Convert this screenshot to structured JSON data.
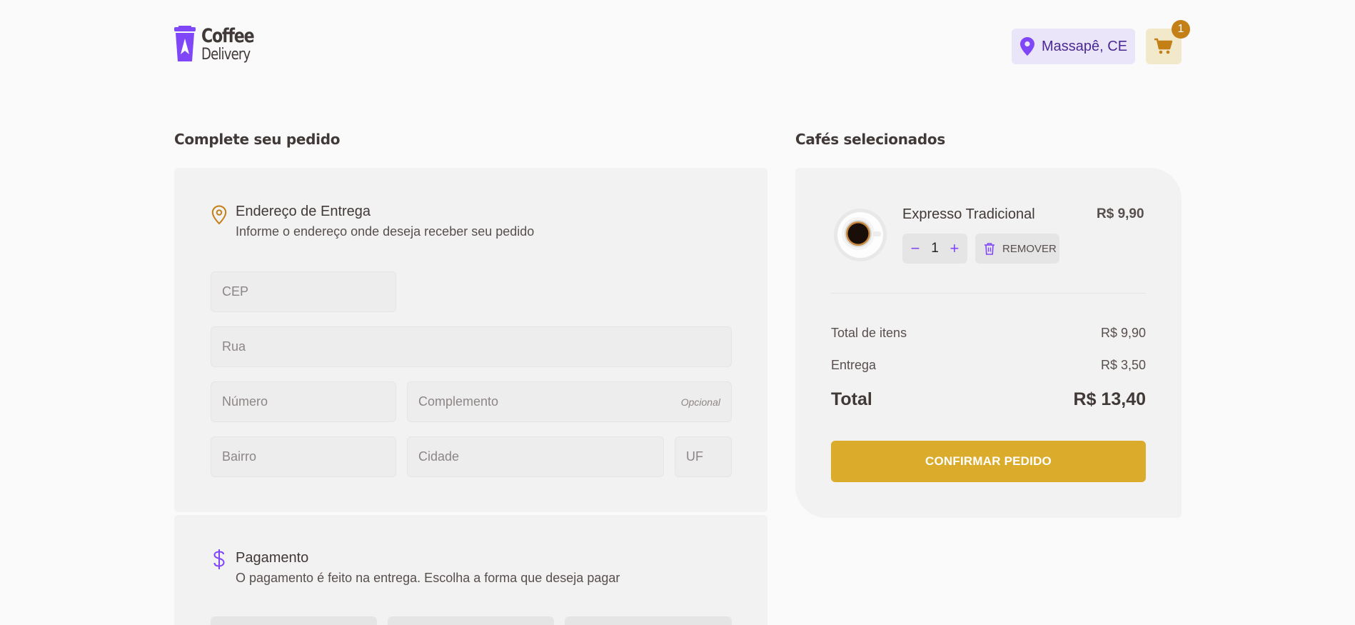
{
  "brand": {
    "line1": "Coffee",
    "line2": "Delivery"
  },
  "header": {
    "location": "Massapê, CE",
    "cart_count": "1"
  },
  "checkout": {
    "title": "Complete seu pedido",
    "address": {
      "title": "Endereço de Entrega",
      "subtitle": "Informe o endereço onde deseja receber seu pedido",
      "fields": {
        "cep": "CEP",
        "rua": "Rua",
        "numero": "Número",
        "complemento": "Complemento",
        "complemento_hint": "Opcional",
        "bairro": "Bairro",
        "cidade": "Cidade",
        "uf": "UF"
      }
    },
    "payment": {
      "title": "Pagamento",
      "subtitle": "O pagamento é feito na entrega. Escolha a forma que deseja pagar"
    }
  },
  "summary": {
    "title": "Cafés selecionados",
    "item": {
      "name": "Expresso Tradicional",
      "price": "R$ 9,90",
      "quantity": "1",
      "remove_label": "REMOVER"
    },
    "totals": {
      "items_label": "Total de itens",
      "items_value": "R$ 9,90",
      "delivery_label": "Entrega",
      "delivery_value": "R$ 3,50",
      "total_label": "Total",
      "total_value": "R$ 13,40"
    },
    "confirm_label": "CONFIRMAR PEDIDO"
  },
  "colors": {
    "purple": "#8047F8",
    "yellow": "#DBAC2C",
    "yellow_dark": "#C47F17",
    "purple_light": "#EBE5F9"
  }
}
